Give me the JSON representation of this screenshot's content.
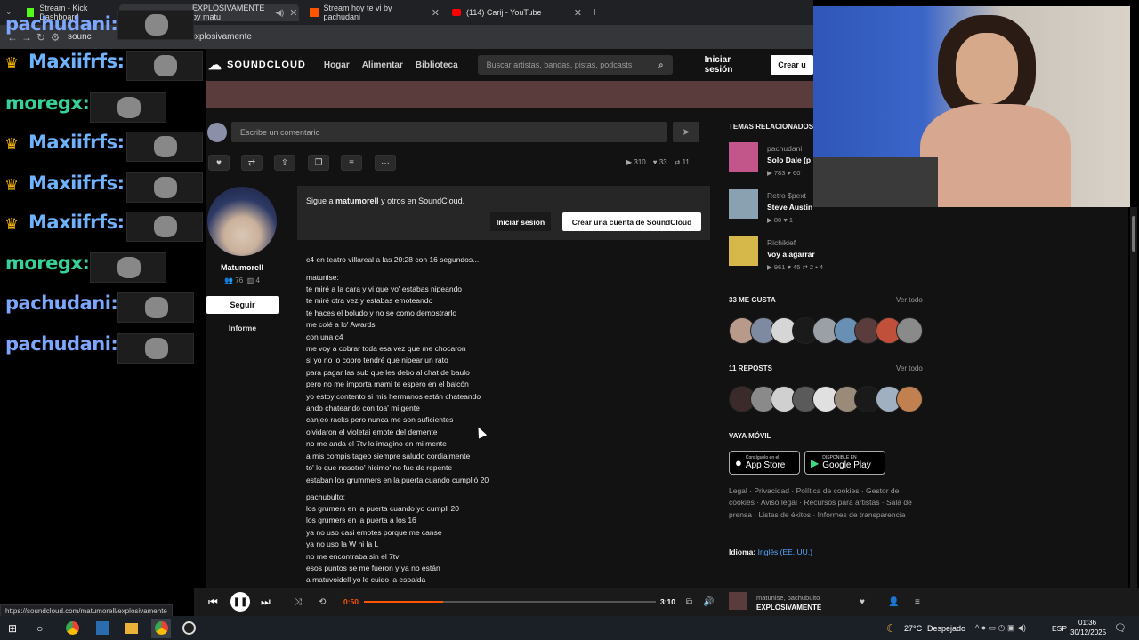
{
  "browser": {
    "tabs": [
      {
        "label": "Stream - Kick Dashboard",
        "icon": "kick-icon"
      },
      {
        "label": "EXPLOSIVAMENTE by matu",
        "icon": "soundcloud-icon"
      },
      {
        "label": "Stream hoy te vi by pachudani",
        "icon": "soundcloud-icon"
      },
      {
        "label": "(114) Carij - YouTube",
        "icon": "youtube-icon"
      }
    ],
    "url": "soundcloud.com/matumorell/explosivamente",
    "url_left": "sounc",
    "new_tab": "+"
  },
  "sc": {
    "logo": "SOUNDCLOUD",
    "nav": [
      "Hogar",
      "Alimentar",
      "Biblioteca"
    ],
    "search_placeholder": "Buscar artistas, bandas, pistas, podcasts",
    "login": "Iniciar sesión",
    "create": "Crear u"
  },
  "comment": {
    "placeholder": "Escribe un comentario"
  },
  "stats": {
    "plays": "310",
    "likes": "33",
    "reposts": "11"
  },
  "artist": {
    "name": "Matumorell",
    "followers": "76",
    "tracks": "4",
    "follow": "Seguir",
    "report": "Informe"
  },
  "follow_box": {
    "prefix": "Sigue a",
    "artist": "matumorell",
    "suffix": "y otros en SoundCloud.",
    "login": "Iniciar sesión",
    "create": "Crear una cuenta de SoundCloud"
  },
  "description": {
    "intro": "c4 en teatro villareal a las 20:28 con 16 segundos...",
    "p1_head": "matunise:",
    "p1": [
      "te miré a la cara y vi que vo' estabas nipeando",
      "te miré otra vez y estabas emoteando",
      "te haces el boludo y no se como demostrarlo",
      "me colé a lo' Awards",
      "con una c4",
      "me voy a cobrar toda esa vez que me chocaron",
      "si yo no lo cobro tendré que nipear un rato",
      "para pagar las sub que les debo al chat de baulo",
      "pero no me importa mami te espero en el balcón",
      "yo estoy contento si mis hermanos están chateando",
      "ando chateando con toa' mi gente",
      "canjeo racks pero nunca me son suficientes",
      "olvidaron el violetai emote del demente",
      "no me anda el 7tv lo imagino en mi mente",
      "a mis compis tageo siempre saludo cordialmente",
      "to' lo que nosotro' hicimo' no fue de repente",
      "estaban los grummers en la puerta cuando cumplió 20"
    ],
    "p2_head": "pachubulto:",
    "p2": [
      "los grumers en la puerta cuando yo cumpli 20",
      "los grumers en la puerta a los 16",
      "ya no uso casi emotes porque me canse",
      "ya no uso la W ni la L",
      "no me encontraba sin el 7tv",
      "esos puntos se me fueron y ya no están",
      "a matuvoidell yo le cuido la espalda"
    ]
  },
  "sidebar": {
    "related_title": "TEMAS RELACIONADOS",
    "related": [
      {
        "user": "pachudani",
        "title": "Solo Dale (p",
        "plays": "783",
        "likes": "60",
        "reposts": "",
        "comments": ""
      },
      {
        "user": "Retro $pext",
        "title": "Steve Austin",
        "plays": "80",
        "likes": "1",
        "reposts": "",
        "comments": ""
      },
      {
        "user": "Richikief",
        "title": "Voy a agarrar",
        "plays": "961",
        "likes": "45",
        "reposts": "2",
        "comments": "4"
      }
    ],
    "likes_title": "33 ME GUSTA",
    "reposts_title": "11 REPOSTS",
    "view_all": "Ver todo",
    "mobile_title": "VAYA MÓVIL",
    "appstore_small": "Consíguelo en el",
    "appstore": "App Store",
    "play_small": "DISPONIBLE EN",
    "play": "Google Play",
    "footer": "Legal · Privacidad · Política de cookies · Gestor de cookies · Aviso legal · Recursos para artistas · Sala de prensa · Listas de éxitos · Informes de transparencia",
    "lang_label": "Idioma:",
    "lang": "Inglés (EE. UU.)"
  },
  "chat": [
    {
      "name": "pachudani:",
      "color": "#7da7ff",
      "crown": false
    },
    {
      "name": "Maxiifrfs:",
      "color": "#6fb3ff",
      "crown": true
    },
    {
      "name": "moregx:",
      "color": "#35d39a",
      "crown": false
    },
    {
      "name": "Maxiifrfs:",
      "color": "#6fb3ff",
      "crown": true
    },
    {
      "name": "Maxiifrfs:",
      "color": "#6fb3ff",
      "crown": true
    },
    {
      "name": "Maxiifrfs:",
      "color": "#6fb3ff",
      "crown": true
    },
    {
      "name": "moregx:",
      "color": "#35d39a",
      "crown": false
    },
    {
      "name": "pachudani:",
      "color": "#7da7ff",
      "crown": false
    },
    {
      "name": "pachudani:",
      "color": "#7da7ff",
      "crown": false
    }
  ],
  "player": {
    "elapsed": "0:50",
    "total": "3:10",
    "progress": 0.27,
    "artist": "matunise, pachubulto",
    "title": "EXPLOSIVAMENTE"
  },
  "status_url": "https://soundcloud.com/matumorell/explosivamente",
  "taskbar": {
    "weather": "27°C",
    "weather_desc": "Despejado",
    "lang": "ESP",
    "time": "01:36",
    "date": "30/12/2025"
  }
}
